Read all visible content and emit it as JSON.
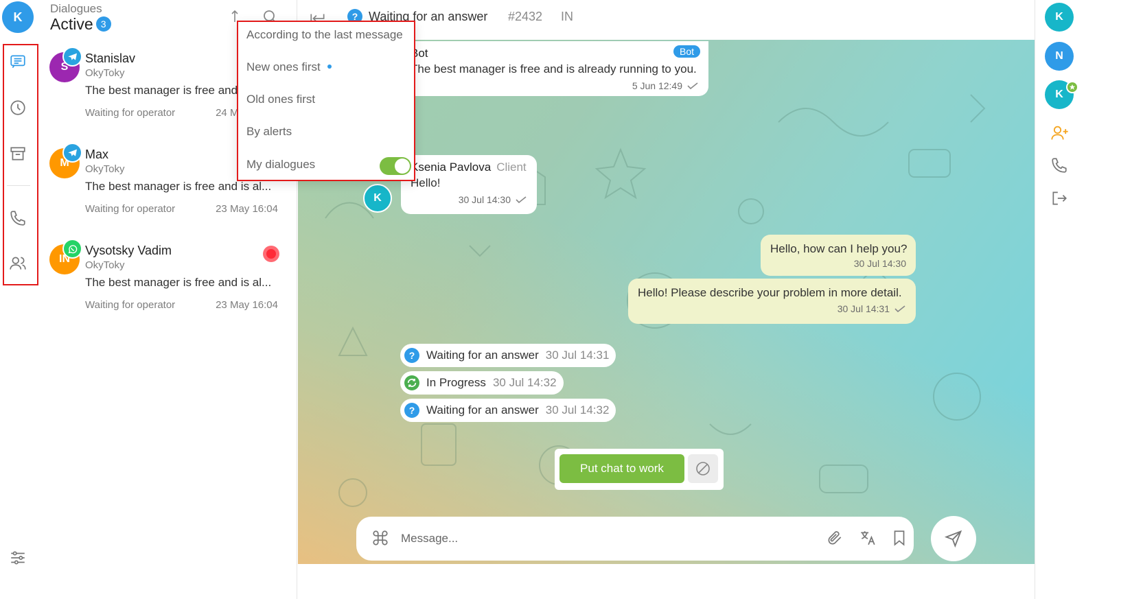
{
  "me": {
    "initial": "K",
    "color": "#2f9be8"
  },
  "left_nav": [
    "chat-icon",
    "clock-icon",
    "archive-icon",
    "phone-icon",
    "users-icon"
  ],
  "dialogues": {
    "caption": "Dialogues",
    "title": "Active",
    "count": "3",
    "items": [
      {
        "initial": "S",
        "color": "#9c27b0",
        "channel": "telegram",
        "name": "Stanislav",
        "source": "OkyToky",
        "text": "The best manager is free and is al...",
        "status": "Waiting for operator",
        "time": "24 May 16:04"
      },
      {
        "initial": "M",
        "color": "#ff9800",
        "channel": "telegram",
        "name": "Max",
        "source": "OkyToky",
        "text": "The best manager is free and is al...",
        "status": "Waiting for operator",
        "time": "23 May 16:04"
      },
      {
        "initial": "IN",
        "color": "#ff9800",
        "channel": "whatsapp",
        "name": "Vysotsky Vadim",
        "source": "OkyToky",
        "text": "The best manager is free and is al...",
        "status": "Waiting for operator",
        "time": "23 May 16:04",
        "alert": true
      }
    ]
  },
  "sort_menu": {
    "items": [
      {
        "label": "According to the last message",
        "active": true
      },
      {
        "label": "New ones first",
        "dot": true
      },
      {
        "label": "Old ones first"
      },
      {
        "label": "By alerts"
      }
    ],
    "toggle_label": "My dialogues",
    "toggle_on": true
  },
  "chat_header": {
    "status": "Waiting for an answer",
    "number": "#2432",
    "direction": "IN"
  },
  "messages": [
    {
      "author": "Bot",
      "badge": "Bot",
      "text": "The best manager is free and is already running to you.",
      "time": "5 Jun 12:49"
    },
    {
      "author": "Ksenia Pavlova",
      "role": "Client",
      "text": "Hello!",
      "time": "30 Jul 14:30",
      "avatar": "K"
    },
    {
      "text": "Hello, how can I help you?",
      "time": "30 Jul 14:30"
    },
    {
      "text": "Hello! Please describe your problem in more detail.",
      "time": "30 Jul 14:31"
    }
  ],
  "events": [
    {
      "icon": "question-icon",
      "glyph": "?",
      "color": "#2f9be8",
      "text": "Waiting for an answer",
      "time": "30 Jul 14:31"
    },
    {
      "icon": "refresh-icon",
      "glyph": "",
      "color": "#4caf50",
      "text": "In Progress",
      "time": "30 Jul 14:32"
    },
    {
      "icon": "question-icon",
      "glyph": "?",
      "color": "#2f9be8",
      "text": "Waiting for an answer",
      "time": "30 Jul 14:32"
    }
  ],
  "actions": {
    "put_to_work": "Put chat to work"
  },
  "composer": {
    "placeholder": "Message..."
  },
  "right_rail": {
    "operators": [
      {
        "initial": "K",
        "color": "#17b6c9"
      },
      {
        "initial": "N",
        "color": "#2f9be8"
      },
      {
        "initial": "K",
        "color": "#17b6c9",
        "star": true
      }
    ]
  }
}
